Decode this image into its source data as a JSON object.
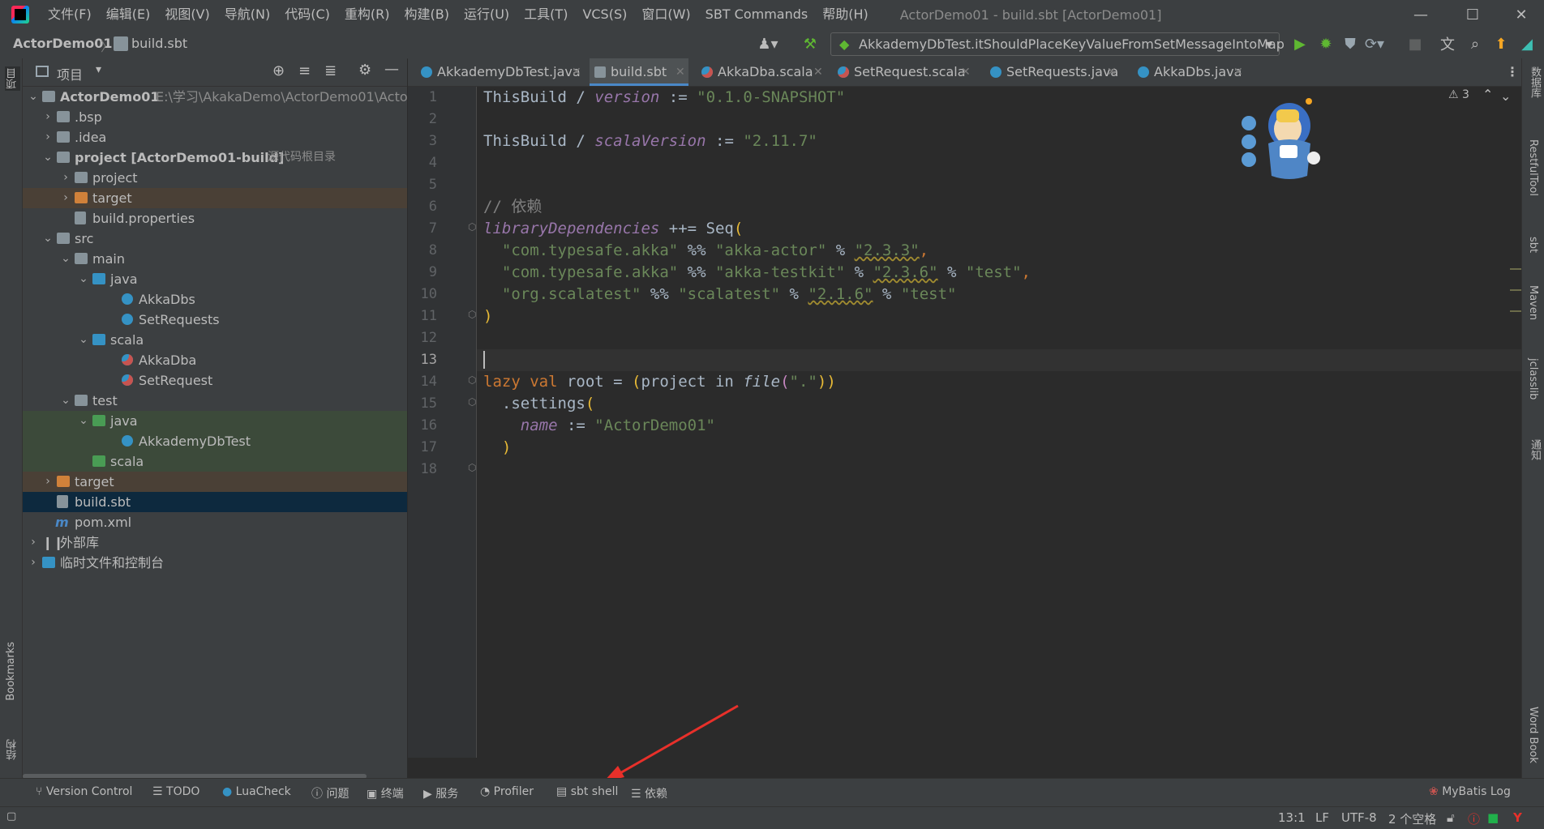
{
  "titlebar": {
    "menus": [
      "文件(F)",
      "编辑(E)",
      "视图(V)",
      "导航(N)",
      "代码(C)",
      "重构(R)",
      "构建(B)",
      "运行(U)",
      "工具(T)",
      "VCS(S)",
      "窗口(W)",
      "SBT Commands",
      "帮助(H)"
    ],
    "window_title": "ActorDemo01 - build.sbt [ActorDemo01]"
  },
  "navbar": {
    "project": "ActorDemo01",
    "file": "build.sbt",
    "run_config": "AkkademyDbTest.itShouldPlaceKeyValueFromSetMessageIntoMap"
  },
  "left_stripe": {
    "project_label": "项目",
    "bookmarks_label": "Bookmarks",
    "structure_label": "结构"
  },
  "project_panel": {
    "title": "项目",
    "tree": [
      {
        "label": "ActorDemo01",
        "extra": "E:\\学习\\AkakaDemo\\ActorDemo01\\ActorD",
        "bold": true
      },
      {
        "label": ".bsp"
      },
      {
        "label": ".idea"
      },
      {
        "label": "project [ActorDemo01-build]",
        "extra": "源代码根目录",
        "bold": true
      },
      {
        "label": "project"
      },
      {
        "label": "target"
      },
      {
        "label": "build.properties"
      },
      {
        "label": "src"
      },
      {
        "label": "main"
      },
      {
        "label": "java"
      },
      {
        "label": "AkkaDbs"
      },
      {
        "label": "SetRequests"
      },
      {
        "label": "scala"
      },
      {
        "label": "AkkaDba"
      },
      {
        "label": "SetRequest"
      },
      {
        "label": "test"
      },
      {
        "label": "java"
      },
      {
        "label": "AkkademyDbTest"
      },
      {
        "label": "scala"
      },
      {
        "label": "target"
      },
      {
        "label": "build.sbt"
      },
      {
        "label": "pom.xml"
      },
      {
        "label": "外部库"
      },
      {
        "label": "临时文件和控制台"
      }
    ]
  },
  "tabs": [
    "AkkademyDbTest.java",
    "build.sbt",
    "AkkaDba.scala",
    "SetRequest.scala",
    "SetRequests.java",
    "AkkaDbs.java"
  ],
  "editor": {
    "warning_count": "3",
    "line_numbers": [
      "1",
      "2",
      "3",
      "4",
      "5",
      "6",
      "7",
      "8",
      "9",
      "10",
      "11",
      "12",
      "13",
      "14",
      "15",
      "16",
      "17",
      "18"
    ],
    "code": {
      "l1_a": "ThisBuild / ",
      "l1_b": "version",
      "l1_c": " := ",
      "l1_d": "\"0.1.0-SNAPSHOT\"",
      "l3_a": "ThisBuild / ",
      "l3_b": "scalaVersion",
      "l3_c": " := ",
      "l3_d": "\"2.11.7\"",
      "l6": "// 依赖",
      "l7_a": "libraryDependencies",
      "l7_b": " ++= Seq",
      "l7_c": "(",
      "l8_a": "  \"com.typesafe.akka\"",
      "l8_b": " %% ",
      "l8_c": "\"akka-actor\"",
      "l8_d": " % ",
      "l8_e": "\"2.3.3\"",
      "l8_f": ",",
      "l9_a": "  \"com.typesafe.akka\"",
      "l9_b": " %% ",
      "l9_c": "\"akka-testkit\"",
      "l9_d": " % ",
      "l9_e": "\"2.3.6\"",
      "l9_f": " % ",
      "l9_g": "\"test\"",
      "l9_h": ",",
      "l10_a": "  \"org.scalatest\"",
      "l10_b": " %% ",
      "l10_c": "\"scalatest\"",
      "l10_d": " % ",
      "l10_e": "\"2.1.6\"",
      "l10_f": " % ",
      "l10_g": "\"test\"",
      "l11": ")",
      "l14_a": "lazy val",
      "l14_b": " root = ",
      "l14_c": "(",
      "l14_d": "project in ",
      "l14_e": "file",
      "l14_f": "(",
      "l14_g": "\".\"",
      "l14_h": "))",
      "l15_a": "  .settings",
      "l15_b": "(",
      "l16_a": "    name",
      "l16_b": " := ",
      "l16_c": "\"ActorDemo01\"",
      "l17": "  )"
    }
  },
  "right_stripe": [
    "数据库",
    "RestfulTool",
    "sbt",
    "Maven",
    "jclasslib",
    "通知",
    "Word Book"
  ],
  "bottom_tools": [
    "Version Control",
    "TODO",
    "LuaCheck",
    "问题",
    "终端",
    "服务",
    "Profiler",
    "sbt shell",
    "依赖",
    "MyBatis Log"
  ],
  "status": {
    "position": "13:1",
    "line_sep": "LF",
    "encoding": "UTF-8",
    "indent": "2 个空格"
  },
  "colors": {
    "accent": "#4a88c7",
    "string": "#6a8759",
    "keyword": "#cc7832",
    "annotation_arrow": "#e8302a"
  }
}
